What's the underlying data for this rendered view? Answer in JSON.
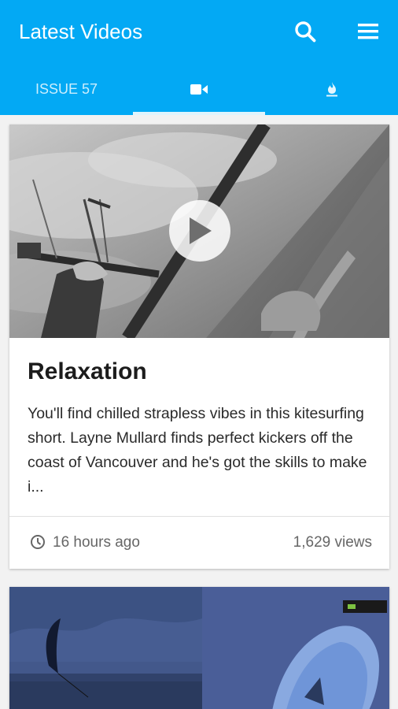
{
  "header": {
    "title": "Latest Videos",
    "icons": [
      "search-icon",
      "menu-icon"
    ],
    "color": "#03a9f4"
  },
  "tabs": [
    {
      "label": "ISSUE 57",
      "active": false
    },
    {
      "icon": "video-camera-icon",
      "active": true
    },
    {
      "icon": "flame-icon",
      "active": false
    }
  ],
  "videos": [
    {
      "title": "Relaxation",
      "description": "You'll find chilled strapless vibes in this kitesurfing short. Layne Mullard finds perfect kickers off the coast of Vancouver and he's got the skills to make i...",
      "time_ago": "16 hours ago",
      "views": "1,629 views"
    }
  ]
}
